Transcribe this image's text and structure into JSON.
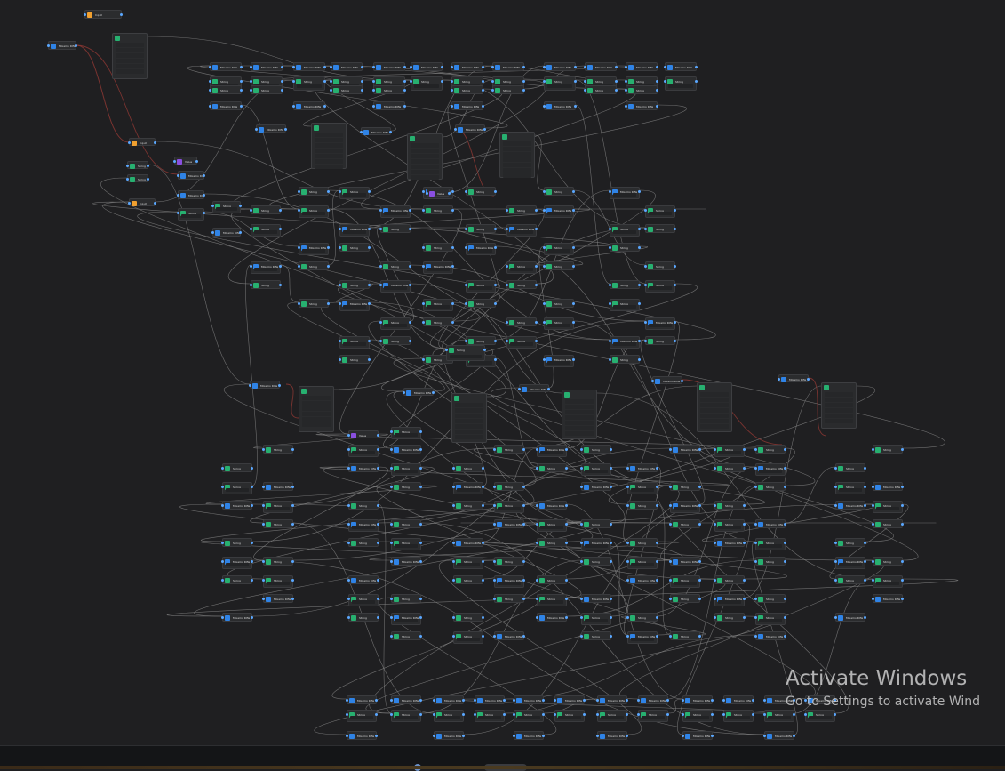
{
  "app": {
    "canvas_label": "Node graph editor canvas"
  },
  "colors": {
    "background": "#1f1f21",
    "node": "#2b2c2e",
    "port": "#5aa7ff",
    "wire": "#8a8a8a",
    "wire_red": "#9a3b35",
    "icon_blue": "#2f83e6",
    "icon_green": "#27b070",
    "icon_orange": "#f0a030",
    "icon_purple": "#8a4fe0"
  },
  "watermark": {
    "title": "Activate Windows",
    "subtitle": "Go to Settings to activate Wind"
  },
  "node_label_samples": {
    "blue": "Mixamo Rifle",
    "green": "String",
    "orange": "Input",
    "purple": "Value"
  }
}
